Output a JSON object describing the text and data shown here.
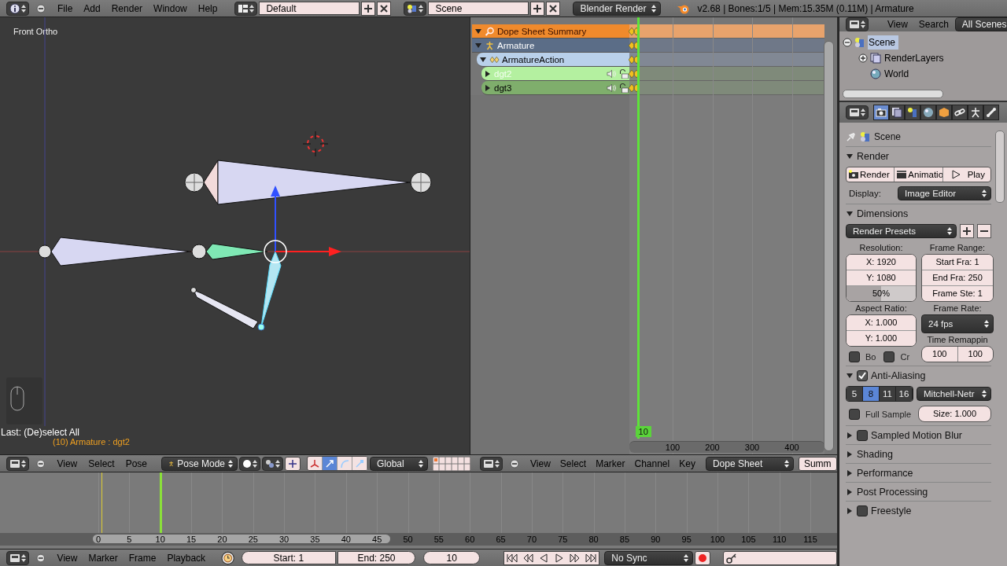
{
  "top_bar": {
    "menus": [
      "File",
      "Add",
      "Render",
      "Window",
      "Help"
    ],
    "layout": "Default",
    "scene": "Scene",
    "engine": "Blender Render",
    "info": "v2.68 | Bones:1/5  | Mem:15.35M (0.11M) | Armature"
  },
  "viewport": {
    "view_label": "Front Ortho",
    "last_operator": "Last: (De)select All",
    "selection_info": "(10) Armature : dgt2",
    "header": {
      "menus": [
        "View",
        "Select",
        "Pose"
      ],
      "mode": "Pose Mode",
      "orientation": "Global"
    }
  },
  "dope_sheet": {
    "channels": [
      {
        "kind": "summary",
        "name": "Dope Sheet Summary",
        "expanded": true,
        "selected": false
      },
      {
        "kind": "object",
        "name": "Armature",
        "expanded": true,
        "selected": false
      },
      {
        "kind": "action",
        "name": "ArmatureAction",
        "expanded": true,
        "selected": false
      },
      {
        "kind": "group",
        "name": "dgt2",
        "expanded": false,
        "selected": true
      },
      {
        "kind": "group",
        "name": "dgt3",
        "expanded": false,
        "selected": false
      }
    ],
    "current_frame": "10",
    "ruler_labels": [
      "100",
      "200",
      "300",
      "400"
    ],
    "header": {
      "menus": [
        "View",
        "Select",
        "Marker",
        "Channel",
        "Key"
      ],
      "mode": "Dope Sheet",
      "summary_label": "Summ"
    }
  },
  "outliner": {
    "menus": [
      "View",
      "Search"
    ],
    "display": "All Scenes",
    "tree": [
      {
        "kind": "scene",
        "name": "Scene",
        "expanded": true,
        "selected": true,
        "children": [
          {
            "kind": "layers",
            "name": "RenderLayers",
            "expanded": false,
            "selected": false
          },
          {
            "kind": "world",
            "name": "World",
            "selected": false
          }
        ]
      }
    ]
  },
  "properties": {
    "tabs": [
      {
        "kind": "render",
        "selected": true
      },
      {
        "kind": "layers",
        "selected": false
      },
      {
        "kind": "scene",
        "selected": false
      },
      {
        "kind": "world",
        "selected": false
      },
      {
        "kind": "object",
        "selected": false
      },
      {
        "kind": "constraints",
        "selected": false
      },
      {
        "kind": "data",
        "selected": false
      },
      {
        "kind": "bone",
        "selected": false
      }
    ],
    "context": "Scene",
    "panels": [
      {
        "kind": "render",
        "title": "Render",
        "expanded": true,
        "buttons": [
          "Render",
          "Animatio",
          "Play"
        ],
        "display_label": "Display:",
        "display_value": "Image Editor"
      },
      {
        "kind": "dimensions",
        "title": "Dimensions",
        "expanded": true,
        "presets": "Render Presets",
        "resolution_label": "Resolution:",
        "resolution_x": "X: 1920",
        "resolution_y": "Y: 1080",
        "percentage": {
          "text": "50%",
          "level": 0.5
        },
        "frame_range_label": "Frame Range:",
        "frame_start": "Start Fra: 1",
        "frame_end": "End Fra: 250",
        "frame_step": "Frame Ste: 1",
        "aspect_label": "Aspect Ratio:",
        "aspect_x": "X: 1.000",
        "aspect_y": "Y: 1.000",
        "frame_rate_label": "Frame Rate:",
        "frame_rate": "24 fps",
        "border": {
          "label": "Bo",
          "checked": false
        },
        "crop": {
          "label": "Cr",
          "checked": false
        },
        "remap_label": "Time Remappin",
        "remap_old": "100",
        "remap_new": "100"
      },
      {
        "kind": "antialiasing",
        "title": "Anti-Aliasing",
        "expanded": true,
        "enabled": true,
        "samples": [
          {
            "label": "5",
            "selected": false
          },
          {
            "label": "8",
            "selected": true
          },
          {
            "label": "11",
            "selected": false
          },
          {
            "label": "16",
            "selected": false
          }
        ],
        "filter": "Mitchell-Netr",
        "full_sample": {
          "label": "Full Sample",
          "checked": false
        },
        "size": "Size: 1.000"
      },
      {
        "kind": "collapsed",
        "title": "Sampled Motion Blur",
        "expanded": false,
        "enabled": false
      },
      {
        "kind": "collapsed",
        "title": "Shading",
        "expanded": false
      },
      {
        "kind": "collapsed",
        "title": "Performance",
        "expanded": false
      },
      {
        "kind": "collapsed",
        "title": "Post Processing",
        "expanded": false
      },
      {
        "kind": "collapsed",
        "title": "Freestyle",
        "expanded": false,
        "enabled": false
      }
    ]
  },
  "timeline": {
    "ruler_labels": [
      "0",
      "5",
      "10",
      "15",
      "20",
      "25",
      "30",
      "35",
      "40",
      "45",
      "50",
      "55",
      "60",
      "65",
      "70",
      "75",
      "80",
      "85",
      "90",
      "95",
      "100",
      "105",
      "110",
      "115"
    ],
    "header": {
      "menus": [
        "View",
        "Marker",
        "Frame",
        "Playback"
      ],
      "start": "Start: 1",
      "end": "End: 250",
      "frame": "10",
      "sync": "No Sync"
    }
  }
}
